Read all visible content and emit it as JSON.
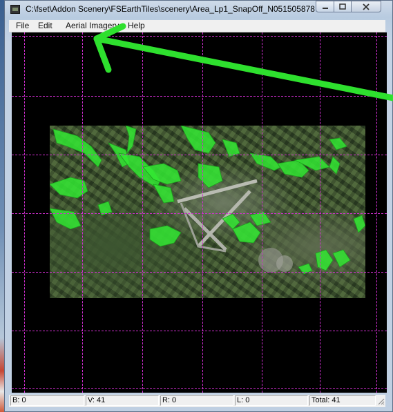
{
  "window": {
    "title": "C:\\fset\\Addon Scenery\\FSEarthTiles\\scenery\\Area_Lp1_SnapOff_N051505878...",
    "controls": {
      "minimize": "minimize-icon",
      "maximize": "maximize-icon",
      "close": "close-icon"
    }
  },
  "menu": {
    "file": "File",
    "edit": "Edit",
    "aerial": "Aerial Imagery",
    "help": "Help"
  },
  "status": {
    "b": "B: 0",
    "v": "V: 41",
    "r": "R: 0",
    "l": "L: 0",
    "total": "Total: 41"
  },
  "colors": {
    "grid": "#d12fd1",
    "polygon": "#33e833",
    "arrow": "#2ee02e",
    "background": "#000000"
  }
}
